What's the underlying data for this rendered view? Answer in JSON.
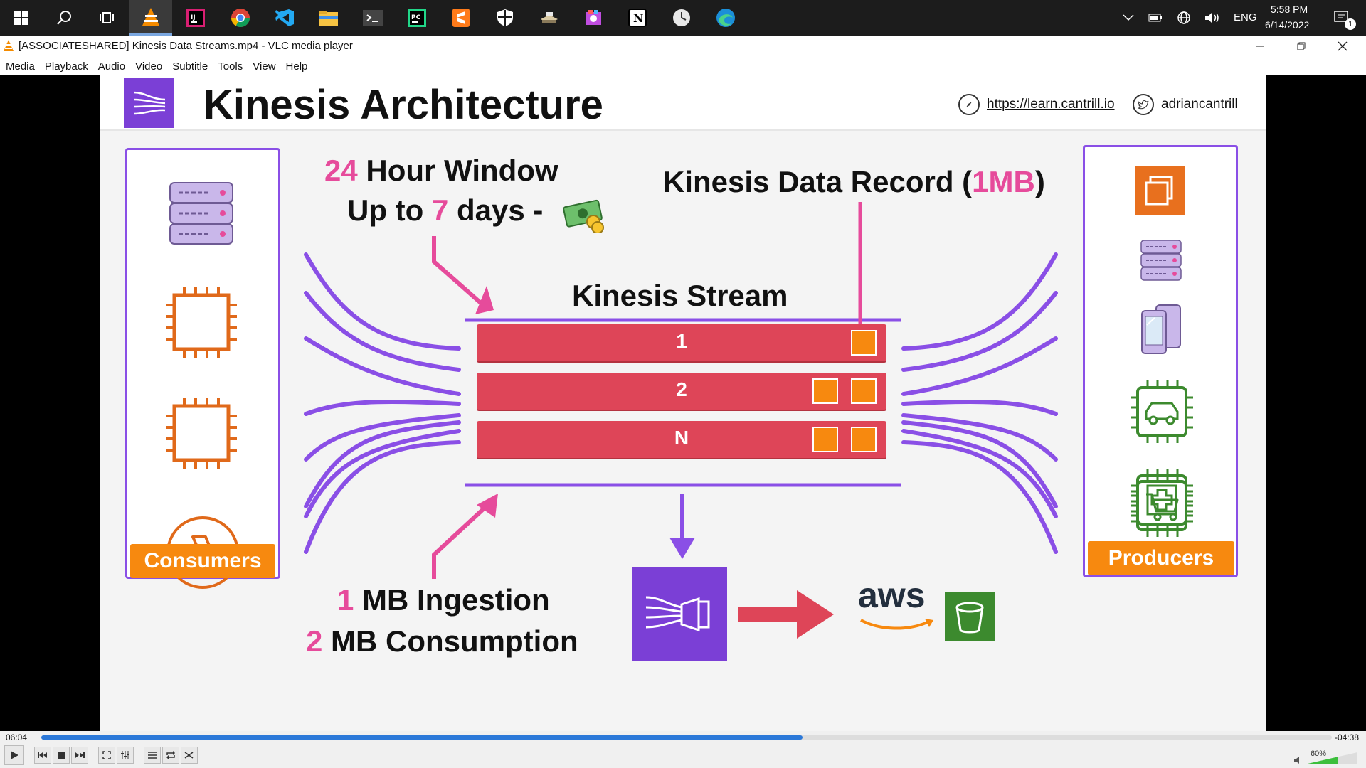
{
  "taskbar": {
    "tray": {
      "language": "ENG",
      "time": "5:58 PM",
      "date": "6/14/2022",
      "notifications": "1"
    }
  },
  "window": {
    "title": "[ASSOCIATESHARED] Kinesis Data Streams.mp4 - VLC media player"
  },
  "menu": [
    "Media",
    "Playback",
    "Audio",
    "Video",
    "Subtitle",
    "Tools",
    "View",
    "Help"
  ],
  "slide": {
    "title": "Kinesis Architecture",
    "link_url": "https://learn.cantrill.io",
    "link_handle": "adriancantrill",
    "window_num": "24",
    "window_text": " Hour Window",
    "days_pre": "Up to ",
    "days_num": "7",
    "days_post": " days -",
    "record_pre": "Kinesis Data Record (",
    "record_size": "1MB",
    "record_post": ")",
    "stream_label": "Kinesis Stream",
    "shards": [
      {
        "label": "1",
        "records": 1
      },
      {
        "label": "2",
        "records": 2
      },
      {
        "label": "N",
        "records": 2
      }
    ],
    "ingest_num": "1",
    "ingest_text": " MB Ingestion",
    "consume_num": "2",
    "consume_text": " MB Consumption",
    "aws_text": "aws",
    "consumers_label": "Consumers",
    "producers_label": "Producers"
  },
  "player": {
    "elapsed": "06:04",
    "remaining": "-04:38",
    "progress": 0.59,
    "volume": "60%"
  },
  "colors": {
    "accent_purple": "#8a4fe6",
    "shard_red": "#de4558",
    "record_orange": "#f7890f",
    "highlight_pink": "#e64b9b",
    "consumer_orange": "#e0691a",
    "producer_green": "#3c8a2e"
  }
}
